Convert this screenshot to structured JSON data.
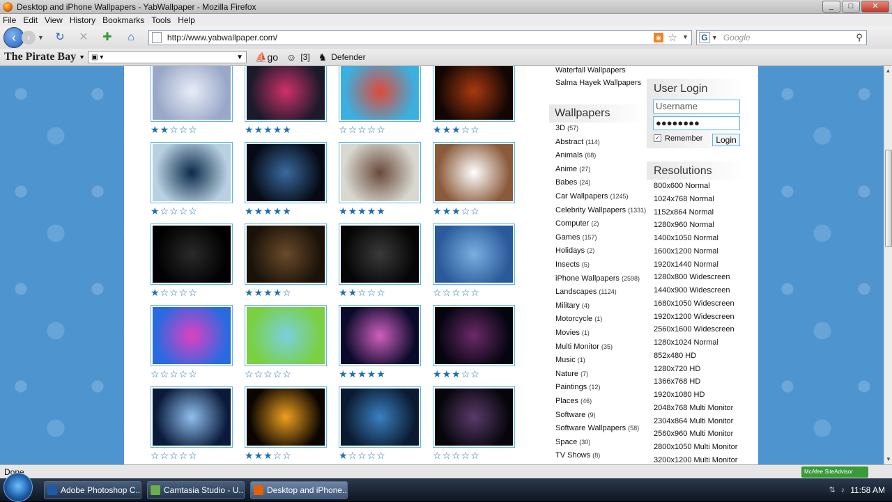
{
  "window": {
    "title": "Desktop and iPhone Wallpapers - YabWallpaper - Mozilla Firefox",
    "min": "_",
    "max": "□",
    "close": "✕"
  },
  "menu": [
    "File",
    "Edit",
    "View",
    "History",
    "Bookmarks",
    "Tools",
    "Help"
  ],
  "nav": {
    "url": "http://www.yabwallpaper.com/",
    "search_placeholder": "Google"
  },
  "toolbar2": {
    "logo": "The Pirate Bay",
    "count": "[3]",
    "defender": "Defender"
  },
  "thumbs": [
    {
      "colors": [
        "#e8eef8",
        "#9aa8c8"
      ],
      "stars": 2
    },
    {
      "colors": [
        "#d0306a",
        "#1a1a2a"
      ],
      "stars": 5
    },
    {
      "colors": [
        "#e04a3a",
        "#3ab0e0"
      ],
      "stars": 0
    },
    {
      "colors": [
        "#a83a10",
        "#120603"
      ],
      "stars": 3
    },
    {
      "colors": [
        "#0a2a4a",
        "#b8d0e0"
      ],
      "stars": 1
    },
    {
      "colors": [
        "#3a6aa0",
        "#050a14"
      ],
      "stars": 5
    },
    {
      "colors": [
        "#6a4a3a",
        "#d8d8d0"
      ],
      "stars": 5
    },
    {
      "colors": [
        "#ffffff",
        "#8a5a3a"
      ],
      "stars": 3
    },
    {
      "colors": [
        "#2a2a2a",
        "#000000"
      ],
      "stars": 1
    },
    {
      "colors": [
        "#6a4a2a",
        "#1a1208"
      ],
      "stars": 4
    },
    {
      "colors": [
        "#3a3a3a",
        "#050505"
      ],
      "stars": 2
    },
    {
      "colors": [
        "#7ab0e0",
        "#2a5a9a"
      ],
      "stars": 0
    },
    {
      "colors": [
        "#e040c0",
        "#2a6ae0"
      ],
      "stars": 0
    },
    {
      "colors": [
        "#7ad0e0",
        "#7ad040"
      ],
      "stars": 0
    },
    {
      "colors": [
        "#d060c0",
        "#0a0a2a"
      ],
      "stars": 5
    },
    {
      "colors": [
        "#6a2a6a",
        "#050510"
      ],
      "stars": 3
    },
    {
      "colors": [
        "#90c0f0",
        "#0a1a3a"
      ],
      "stars": 0
    },
    {
      "colors": [
        "#f0a020",
        "#0a0500"
      ],
      "stars": 3
    },
    {
      "colors": [
        "#3a80c0",
        "#0a1a30"
      ],
      "stars": 1
    },
    {
      "colors": [
        "#5a3a6a",
        "#05050a"
      ],
      "stars": 0
    }
  ],
  "favorites": [
    "Waterfall Wallpapers",
    "Salma Hayek Wallpapers"
  ],
  "wallpapers_header": "Wallpapers",
  "categories": [
    {
      "name": "3D",
      "count": "(57)"
    },
    {
      "name": "Abstract",
      "count": "(114)"
    },
    {
      "name": "Animals",
      "count": "(68)"
    },
    {
      "name": "Anime",
      "count": "(27)"
    },
    {
      "name": "Babes",
      "count": "(24)"
    },
    {
      "name": "Car Wallpapers",
      "count": "(1245)"
    },
    {
      "name": "Celebrity Wallpapers",
      "count": "(1331)"
    },
    {
      "name": "Computer",
      "count": "(2)"
    },
    {
      "name": "Games",
      "count": "(157)"
    },
    {
      "name": "Holidays",
      "count": "(2)"
    },
    {
      "name": "Insects",
      "count": "(5)"
    },
    {
      "name": "iPhone Wallpapers",
      "count": "(2598)"
    },
    {
      "name": "Landscapes",
      "count": "(1124)"
    },
    {
      "name": "Military",
      "count": "(4)"
    },
    {
      "name": "Motorcycle",
      "count": "(1)"
    },
    {
      "name": "Movies",
      "count": "(1)"
    },
    {
      "name": "Multi Monitor",
      "count": "(35)"
    },
    {
      "name": "Music",
      "count": "(1)"
    },
    {
      "name": "Nature",
      "count": "(7)"
    },
    {
      "name": "Paintings",
      "count": "(12)"
    },
    {
      "name": "Places",
      "count": "(46)"
    },
    {
      "name": "Software",
      "count": "(9)"
    },
    {
      "name": "Software Wallpapers",
      "count": "(58)"
    },
    {
      "name": "Space",
      "count": "(30)"
    },
    {
      "name": "TV Shows",
      "count": "(8)"
    }
  ],
  "login": {
    "title": "User Login",
    "username": "Username",
    "password": "●●●●●●●●",
    "remember": "Remember",
    "button": "Login"
  },
  "resolutions_header": "Resolutions",
  "resolutions": [
    "800x600 Normal",
    "1024x768 Normal",
    "1152x864 Normal",
    "1280x960 Normal",
    "1400x1050 Normal",
    "1600x1200 Normal",
    "1920x1440 Normal",
    "1280x800 Widescreen",
    "1440x900 Widescreen",
    "1680x1050 Widescreen",
    "1920x1200 Widescreen",
    "2560x1600 Widescreen",
    "1280x1024 Normal",
    "852x480 HD",
    "1280x720 HD",
    "1366x768 HD",
    "1920x1080 HD",
    "2048x768 Multi Monitor",
    "2304x864 Multi Monitor",
    "2560x960 Multi Monitor",
    "2800x1050 Multi Monitor",
    "3200x1200 Multi Monitor"
  ],
  "status": {
    "text": "Done",
    "mcafee": "McAfee SiteAdvisor"
  },
  "taskbar": {
    "tasks": [
      {
        "label": "Adobe Photoshop C...",
        "color": "#1e5aa8"
      },
      {
        "label": "Camtasia Studio - U...",
        "color": "#6ab04a"
      },
      {
        "label": "Desktop and iPhone...",
        "color": "#e66000"
      }
    ],
    "clock": "11:58 AM"
  }
}
